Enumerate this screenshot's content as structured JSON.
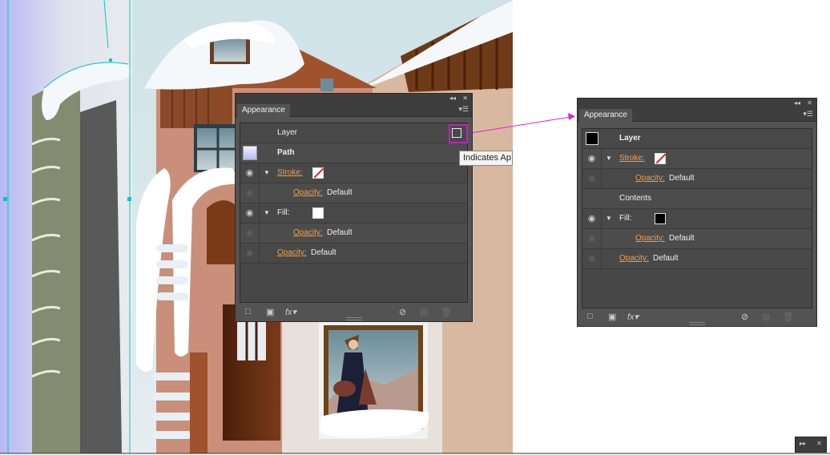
{
  "colors": {
    "accent_link": "#f0a040",
    "panel_bg": "#535353",
    "highlight": "#c020c0",
    "arrow": "#e020e0"
  },
  "panel_left": {
    "tab": "Appearance",
    "rows": [
      {
        "label": "Layer"
      },
      {
        "label": "Path"
      },
      {
        "label": "Stroke:",
        "swatch": "none"
      },
      {
        "label": "Opacity:",
        "value": "Default"
      },
      {
        "label": "Fill:",
        "swatch": "white"
      },
      {
        "label": "Opacity:",
        "value": "Default"
      },
      {
        "label": "Opacity:",
        "value": "Default"
      }
    ],
    "tooltip": "Indicates Ap"
  },
  "panel_right": {
    "tab": "Appearance",
    "rows": [
      {
        "label": "Layer",
        "swatch": "black"
      },
      {
        "label": "Stroke:",
        "swatch": "none"
      },
      {
        "label": "Opacity:",
        "value": "Default"
      },
      {
        "label": "Contents"
      },
      {
        "label": "Fill:",
        "swatch": "black"
      },
      {
        "label": "Opacity:",
        "value": "Default"
      },
      {
        "label": "Opacity:",
        "value": "Default"
      }
    ]
  },
  "icons": {
    "collapse": "double-chevron-left-icon",
    "close": "close-icon",
    "menu": "panel-menu-icon",
    "visibility": "eye-icon",
    "expand": "disclosure-triangle-icon",
    "add_stroke": "add-new-stroke-icon",
    "add_fill": "add-new-fill-icon",
    "fx": "add-effect-icon",
    "clear": "clear-appearance-icon",
    "duplicate": "duplicate-item-icon",
    "delete": "delete-item-icon",
    "target": "layer-target-icon"
  }
}
